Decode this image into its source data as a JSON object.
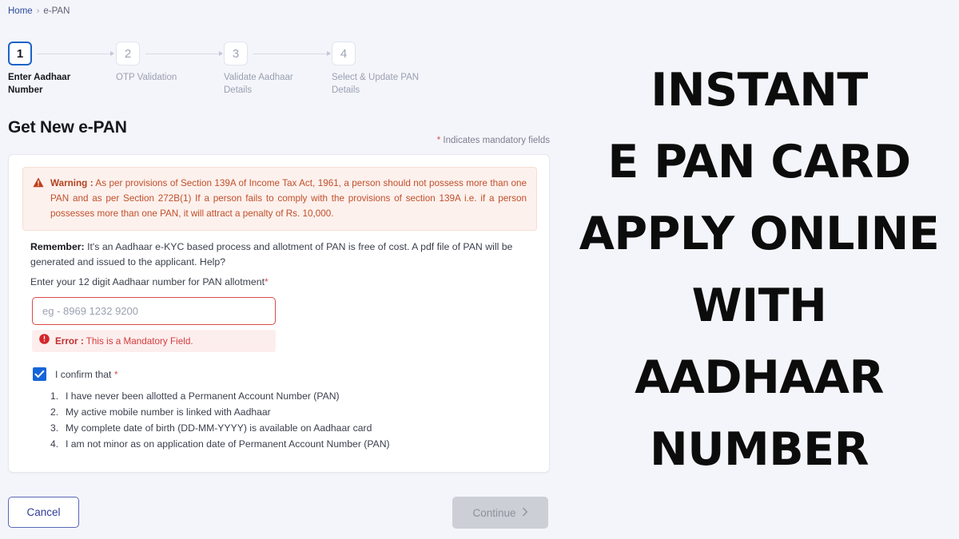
{
  "breadcrumb": {
    "home": "Home",
    "separator": "›",
    "current": "e-PAN"
  },
  "stepper": {
    "steps": [
      {
        "number": "1",
        "label": "Enter Aadhaar Number",
        "state": "active"
      },
      {
        "number": "2",
        "label": "OTP Validation",
        "state": "inactive"
      },
      {
        "number": "3",
        "label": "Validate Aadhaar Details",
        "state": "inactive"
      },
      {
        "number": "4",
        "label": "Select & Update PAN Details",
        "state": "inactive"
      }
    ]
  },
  "page": {
    "title": "Get New e-PAN",
    "mandatory_star": "*",
    "mandatory_note": " Indicates mandatory fields"
  },
  "warning": {
    "icon": "warning-triangle-icon",
    "label": "Warning :",
    "text": " As per provisions of Section 139A of Income Tax Act, 1961, a person should not possess more than one PAN and as per Section 272B(1) If a person fails to comply with the provisions of section 139A i.e. if a person possesses more than one PAN, it will attract a penalty of Rs. 10,000.",
    "bg_color": "#fdf1ed",
    "text_color": "#c0502b"
  },
  "remember": {
    "label": "Remember:",
    "text": " It's an Aadhaar e-KYC based process and allotment of PAN is free of cost. A pdf file of PAN will be generated and issued to the applicant. Help?"
  },
  "aadhaar_field": {
    "label": "Enter your 12 digit Aadhaar number for PAN allotment",
    "required_star": "*",
    "placeholder": "eg - 8969 1232 9200",
    "value": "",
    "border_color": "#d94a4a"
  },
  "error": {
    "icon": "error-circle-icon",
    "label": "Error :",
    "text": " This is a Mandatory Field.",
    "bg_color": "#fdeeee",
    "text_color": "#d23c3c"
  },
  "confirm": {
    "checked": true,
    "checkbox_color": "#1565d8",
    "label": "I confirm that",
    "required_star": "*",
    "items": [
      {
        "num": "1.",
        "text": "I have never been allotted a Permanent Account Number (PAN)"
      },
      {
        "num": "2.",
        "text": "My active mobile number is linked with Aadhaar"
      },
      {
        "num": "3.",
        "text": "My complete date of birth (DD-MM-YYYY) is available on Aadhaar card"
      },
      {
        "num": "4.",
        "text": "I am not minor as on application date of Permanent Account Number (PAN)"
      }
    ]
  },
  "footer": {
    "cancel_label": "Cancel",
    "continue_label": "Continue",
    "continue_icon": "chevron-right-icon",
    "continue_disabled": true
  },
  "promo": {
    "lines": [
      "INSTANT",
      "E PAN CARD",
      "APPLY ONLINE",
      "WITH",
      "AADHAAR",
      "NUMBER"
    ],
    "color": "#0c0c0c",
    "bg_color": "#f4f5fa"
  }
}
